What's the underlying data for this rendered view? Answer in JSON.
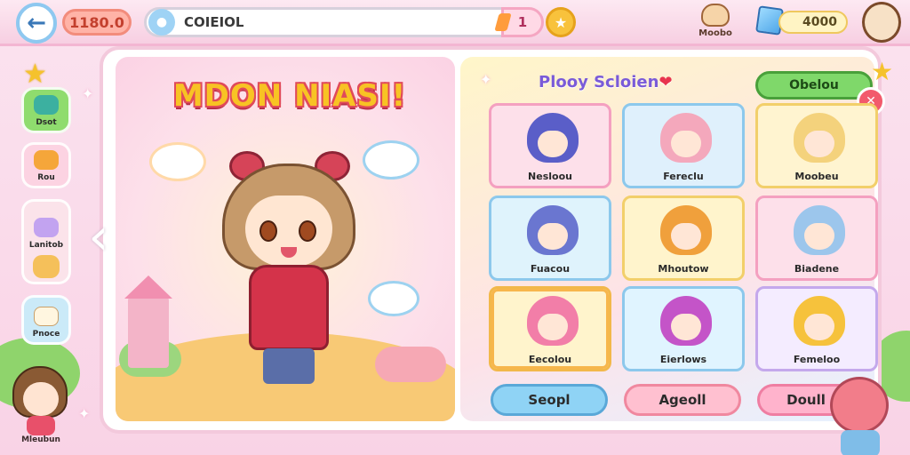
{
  "topbar": {
    "coins": "1180.0",
    "search_label": "COIEIOL",
    "page_number": "1",
    "mode_label": "Moobo",
    "gems": "4000"
  },
  "sidebar": {
    "items": [
      {
        "label": "Dsot"
      },
      {
        "label": "Rou"
      },
      {
        "label": "Lanitob"
      },
      {
        "label": "Pnoce"
      }
    ]
  },
  "hero_panel": {
    "title": "MDON NIASI!"
  },
  "roster": {
    "title": "Plooy Scloien",
    "ribbon_label": "Obelou",
    "characters": [
      {
        "name": "Nesloou",
        "hair": "#5a5ec8",
        "bg": "#fde0ea",
        "border": "#f4a0c0"
      },
      {
        "name": "Fereclu",
        "hair": "#f4a8bc",
        "bg": "#dff0fc",
        "border": "#8cc8ec"
      },
      {
        "name": "Moobeu",
        "hair": "#f4d27c",
        "bg": "#fff4d0",
        "border": "#f2cf6a"
      },
      {
        "name": "Fuacou",
        "hair": "#6a76d0",
        "bg": "#dff3fc",
        "border": "#8cc8ec"
      },
      {
        "name": "Mhoutow",
        "hair": "#f0a03c",
        "bg": "#fff4cc",
        "border": "#f2cf6a"
      },
      {
        "name": "Biadene",
        "hair": "#9cc6ec",
        "bg": "#fde0ea",
        "border": "#f4a0c0"
      },
      {
        "name": "Eecolou",
        "hair": "#f27ea8",
        "bg": "#fff4cc",
        "border": "#f2b84a"
      },
      {
        "name": "Eierlows",
        "hair": "#c454c8",
        "bg": "#e0f4ff",
        "border": "#8cc8ec"
      },
      {
        "name": "Femeloo",
        "hair": "#f6c23c",
        "bg": "#f4ecff",
        "border": "#c4a8ec"
      }
    ],
    "actions": [
      {
        "label": "Seopl"
      },
      {
        "label": "Ageoll"
      },
      {
        "label": "Doull"
      }
    ]
  },
  "footer_character": {
    "label": "Mleubun"
  },
  "colors": {
    "accent_pink": "#f3b6d2",
    "title_yellow": "#f8c324",
    "ribbon_green": "#7fd86a"
  },
  "icons": {
    "back": "back-arrow-icon",
    "search": "search-icon",
    "star": "star-icon",
    "gem": "gem-icon",
    "close": "close-icon",
    "heart": "heart-icon"
  }
}
